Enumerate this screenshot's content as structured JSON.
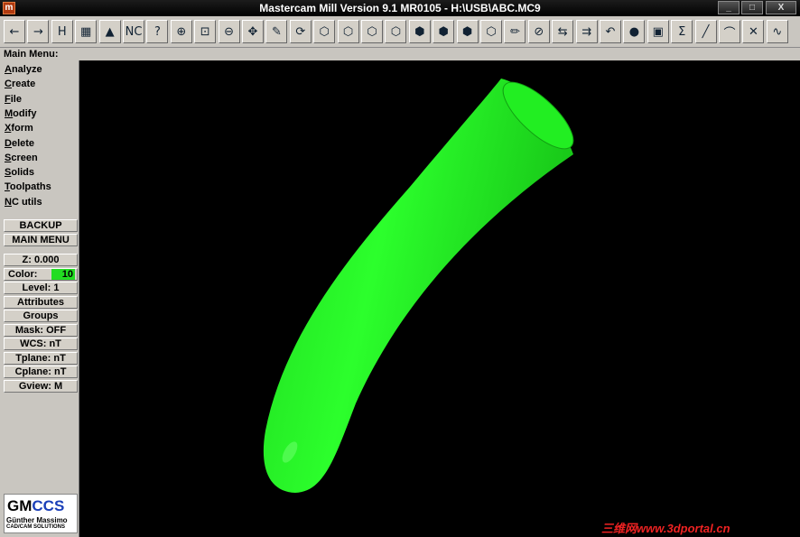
{
  "window": {
    "title": "Mastercam Mill Version 9.1 MR0105 - H:\\USB\\ABC.MC9",
    "app_icon": "m",
    "minimize": "_",
    "maximize": "□",
    "close": "X"
  },
  "toolbar": {
    "buttons": [
      {
        "name": "back-arrow-icon",
        "glyph": "←"
      },
      {
        "name": "forward-arrow-icon",
        "glyph": "→"
      },
      {
        "name": "hst-icon",
        "glyph": "H"
      },
      {
        "name": "select-icon",
        "glyph": "▦"
      },
      {
        "name": "mill-icon",
        "glyph": "▲"
      },
      {
        "name": "nc-data-icon",
        "glyph": "NC"
      },
      {
        "name": "analyze-query-icon",
        "glyph": "?"
      },
      {
        "name": "zoom-window-icon",
        "glyph": "⊕"
      },
      {
        "name": "zoom-fit-icon",
        "glyph": "⊡"
      },
      {
        "name": "zoom-out-icon",
        "glyph": "⊖"
      },
      {
        "name": "pan-icon",
        "glyph": "✥"
      },
      {
        "name": "edit-icon",
        "glyph": "✎"
      },
      {
        "name": "rotate-view-icon",
        "glyph": "⟳"
      },
      {
        "name": "wire-cube-icon",
        "glyph": "⬡"
      },
      {
        "name": "top-view-cube-icon",
        "glyph": "⬡"
      },
      {
        "name": "front-view-cube-icon",
        "glyph": "⬡"
      },
      {
        "name": "side-view-cube-icon",
        "glyph": "⬡"
      },
      {
        "name": "iso-red-cube-icon",
        "glyph": "⬢"
      },
      {
        "name": "iso-red-cube2-icon",
        "glyph": "⬢"
      },
      {
        "name": "iso-red-cube3-icon",
        "glyph": "⬢"
      },
      {
        "name": "3d-cube-icon",
        "glyph": "⬡"
      },
      {
        "name": "shade-icon",
        "glyph": "✏"
      },
      {
        "name": "no-icon",
        "glyph": "⊘"
      },
      {
        "name": "transform-copy-icon",
        "glyph": "⇆"
      },
      {
        "name": "transform-move-icon",
        "glyph": "⇉"
      },
      {
        "name": "undo-icon",
        "glyph": "↶"
      },
      {
        "name": "sphere-icon",
        "glyph": "●"
      },
      {
        "name": "layers-icon",
        "glyph": "▣"
      },
      {
        "name": "sum-icon",
        "glyph": "Σ"
      },
      {
        "name": "line-icon",
        "glyph": "╱"
      },
      {
        "name": "arc-icon",
        "glyph": "⌒"
      },
      {
        "name": "trim-icon",
        "glyph": "✕"
      },
      {
        "name": "spline-icon",
        "glyph": "∿"
      }
    ]
  },
  "menubar": {
    "label": "Main Menu:"
  },
  "main_menu": [
    {
      "hot": "A",
      "rest": "nalyze",
      "name": "menu-analyze"
    },
    {
      "hot": "C",
      "rest": "reate",
      "name": "menu-create"
    },
    {
      "hot": "F",
      "rest": "ile",
      "name": "menu-file"
    },
    {
      "hot": "M",
      "rest": "odify",
      "name": "menu-modify"
    },
    {
      "hot": "X",
      "rest": "form",
      "name": "menu-xform"
    },
    {
      "hot": "D",
      "rest": "elete",
      "name": "menu-delete"
    },
    {
      "hot": "S",
      "rest": "creen",
      "name": "menu-screen"
    },
    {
      "hot": "S",
      "rest": "olids",
      "name": "menu-solids"
    },
    {
      "hot": "T",
      "rest": "oolpaths",
      "name": "menu-toolpaths"
    },
    {
      "hot": "N",
      "rest": "C utils",
      "name": "menu-nc-utils"
    }
  ],
  "nav": {
    "backup": "BACKUP",
    "main_menu": "MAIN MENU"
  },
  "settings": {
    "z": "Z:  0.000",
    "color_label": "Color:",
    "color_value": "10",
    "color_hex": "#22dd22",
    "level": "Level:  1",
    "attributes": "Attributes",
    "groups": "Groups",
    "mask": "Mask:  OFF",
    "wcs": "WCS:  nT",
    "tplane": "Tplane: nT",
    "cplane": "Cplane: nT",
    "gview": "Gview:   M"
  },
  "logo": {
    "main_a": "GM",
    "main_b": "CCS",
    "name": "Günther Massimo",
    "sub": "CAD/CAM SOLUTIONS"
  },
  "viewport": {
    "part_color": "#22ee22",
    "background": "#000000"
  },
  "watermark": "三维网www.3dportal.cn"
}
